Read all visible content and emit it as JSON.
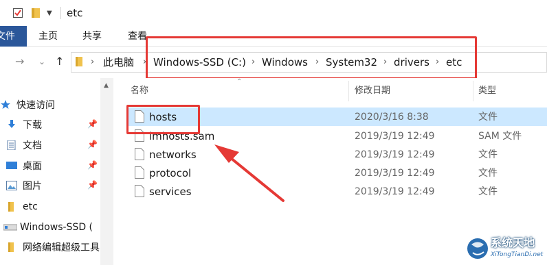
{
  "window": {
    "title": "etc"
  },
  "ribbon": {
    "file_tab": "文件",
    "tabs": [
      "主页",
      "共享",
      "查看"
    ]
  },
  "address": {
    "crumbs": [
      "此电脑",
      "Windows-SSD (C:)",
      "Windows",
      "System32",
      "drivers",
      "etc"
    ]
  },
  "navpane": {
    "items": [
      {
        "label": "快速访问",
        "icon": "star-icon"
      },
      {
        "label": "下载",
        "icon": "download-icon",
        "pinned": true
      },
      {
        "label": "文档",
        "icon": "document-icon",
        "pinned": true
      },
      {
        "label": "桌面",
        "icon": "desktop-icon",
        "pinned": true
      },
      {
        "label": "图片",
        "icon": "picture-icon",
        "pinned": true
      },
      {
        "label": "etc",
        "icon": "folder-icon"
      },
      {
        "label": "Windows-SSD (",
        "icon": "drive-icon"
      },
      {
        "label": "网络编辑超级工具",
        "icon": "folder-icon"
      }
    ]
  },
  "columns": {
    "name": "名称",
    "date": "修改日期",
    "type": "类型"
  },
  "files": [
    {
      "name": "hosts",
      "date": "2020/3/16 8:38",
      "type": "文件",
      "selected": true
    },
    {
      "name": "lmhosts.sam",
      "date": "2019/3/19 12:49",
      "type": "SAM 文件"
    },
    {
      "name": "networks",
      "date": "2019/3/19 12:49",
      "type": "文件"
    },
    {
      "name": "protocol",
      "date": "2019/3/19 12:49",
      "type": "文件"
    },
    {
      "name": "services",
      "date": "2019/3/19 12:49",
      "type": "文件"
    }
  ],
  "watermark": {
    "title": "系统天地",
    "subtitle": "XiTongTianDi.net"
  },
  "colors": {
    "accent": "#2b579a",
    "selection": "#cce8ff",
    "annotation": "#e53935",
    "folder": "#f0c24d"
  }
}
